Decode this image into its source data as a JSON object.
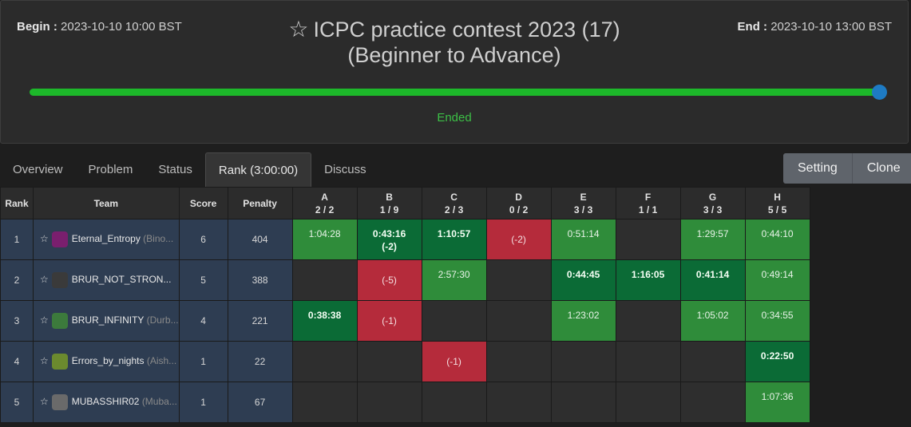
{
  "contest": {
    "begin_label": "Begin :",
    "begin_value": "2023-10-10 10:00 BST",
    "end_label": "End :",
    "end_value": "2023-10-10 13:00 BST",
    "title_line1": "ICPC practice contest 2023 (17)",
    "title_line2": "(Beginner to Advance)",
    "status": "Ended",
    "progress_percent": 100
  },
  "tabs": [
    {
      "label": "Overview"
    },
    {
      "label": "Problem"
    },
    {
      "label": "Status"
    },
    {
      "label": "Rank (3:00:00)"
    },
    {
      "label": "Discuss"
    }
  ],
  "buttons": {
    "setting": "Setting",
    "clone": "Clone"
  },
  "table": {
    "headers": {
      "rank": "Rank",
      "team": "Team",
      "score": "Score",
      "penalty": "Penalty"
    },
    "problems": [
      {
        "letter": "A",
        "ratio": "2 / 2"
      },
      {
        "letter": "B",
        "ratio": "1 / 9"
      },
      {
        "letter": "C",
        "ratio": "2 / 3"
      },
      {
        "letter": "D",
        "ratio": "0 / 2"
      },
      {
        "letter": "E",
        "ratio": "3 / 3"
      },
      {
        "letter": "F",
        "ratio": "1 / 1"
      },
      {
        "letter": "G",
        "ratio": "3 / 3"
      },
      {
        "letter": "H",
        "ratio": "5 / 5"
      }
    ],
    "rows": [
      {
        "rank": "1",
        "name": "Eternal_Entropy",
        "sub": "(Bino...",
        "score": "6",
        "penalty": "404",
        "avatar": "#7a1f6e",
        "cells": [
          {
            "t": "ac",
            "time": "1:04:28",
            "tries": ""
          },
          {
            "t": "first",
            "time": "0:43:16",
            "tries": "(-2)"
          },
          {
            "t": "first",
            "time": "1:10:57",
            "tries": ""
          },
          {
            "t": "wa",
            "time": "",
            "tries": "(-2)"
          },
          {
            "t": "ac",
            "time": "0:51:14",
            "tries": ""
          },
          {
            "t": "empty",
            "time": "",
            "tries": ""
          },
          {
            "t": "ac",
            "time": "1:29:57",
            "tries": ""
          },
          {
            "t": "ac",
            "time": "0:44:10",
            "tries": ""
          }
        ]
      },
      {
        "rank": "2",
        "name": "BRUR_NOT_STRON...",
        "sub": "",
        "score": "5",
        "penalty": "388",
        "avatar": "#3a3a3a",
        "cells": [
          {
            "t": "empty",
            "time": "",
            "tries": ""
          },
          {
            "t": "wa",
            "time": "",
            "tries": "(-5)"
          },
          {
            "t": "ac",
            "time": "2:57:30",
            "tries": ""
          },
          {
            "t": "empty",
            "time": "",
            "tries": ""
          },
          {
            "t": "first",
            "time": "0:44:45",
            "tries": ""
          },
          {
            "t": "first",
            "time": "1:16:05",
            "tries": ""
          },
          {
            "t": "first",
            "time": "0:41:14",
            "tries": ""
          },
          {
            "t": "ac",
            "time": "0:49:14",
            "tries": ""
          }
        ]
      },
      {
        "rank": "3",
        "name": "BRUR_INFINITY",
        "sub": "(Durb...",
        "score": "4",
        "penalty": "221",
        "avatar": "#3c7a3c",
        "cells": [
          {
            "t": "first",
            "time": "0:38:38",
            "tries": ""
          },
          {
            "t": "wa",
            "time": "",
            "tries": "(-1)"
          },
          {
            "t": "empty",
            "time": "",
            "tries": ""
          },
          {
            "t": "empty",
            "time": "",
            "tries": ""
          },
          {
            "t": "ac",
            "time": "1:23:02",
            "tries": ""
          },
          {
            "t": "empty",
            "time": "",
            "tries": ""
          },
          {
            "t": "ac",
            "time": "1:05:02",
            "tries": ""
          },
          {
            "t": "ac",
            "time": "0:34:55",
            "tries": ""
          }
        ]
      },
      {
        "rank": "4",
        "name": "Errors_by_nights",
        "sub": "(Aish...",
        "score": "1",
        "penalty": "22",
        "avatar": "#6b8a2e",
        "cells": [
          {
            "t": "empty",
            "time": "",
            "tries": ""
          },
          {
            "t": "empty",
            "time": "",
            "tries": ""
          },
          {
            "t": "wa",
            "time": "",
            "tries": "(-1)"
          },
          {
            "t": "empty",
            "time": "",
            "tries": ""
          },
          {
            "t": "empty",
            "time": "",
            "tries": ""
          },
          {
            "t": "empty",
            "time": "",
            "tries": ""
          },
          {
            "t": "empty",
            "time": "",
            "tries": ""
          },
          {
            "t": "first",
            "time": "0:22:50",
            "tries": ""
          }
        ]
      },
      {
        "rank": "5",
        "name": "MUBASSHIR02",
        "sub": "(Muba...",
        "score": "1",
        "penalty": "67",
        "avatar": "#6a6a6a",
        "cells": [
          {
            "t": "empty",
            "time": "",
            "tries": ""
          },
          {
            "t": "empty",
            "time": "",
            "tries": ""
          },
          {
            "t": "empty",
            "time": "",
            "tries": ""
          },
          {
            "t": "empty",
            "time": "",
            "tries": ""
          },
          {
            "t": "empty",
            "time": "",
            "tries": ""
          },
          {
            "t": "empty",
            "time": "",
            "tries": ""
          },
          {
            "t": "empty",
            "time": "",
            "tries": ""
          },
          {
            "t": "ac",
            "time": "1:07:36",
            "tries": ""
          }
        ]
      }
    ]
  }
}
